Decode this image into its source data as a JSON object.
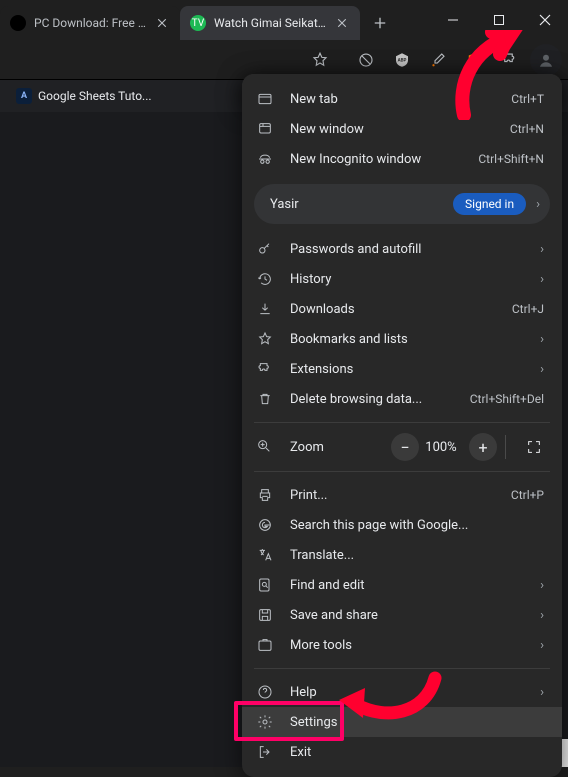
{
  "window": {
    "tabs": [
      {
        "title": "PC Download: Free do",
        "favicon_bg": "#000",
        "active": false
      },
      {
        "title": "Watch Gimai Seikatsu",
        "favicon_bg": "#1db954",
        "favicon_text": "TV",
        "active": true
      }
    ]
  },
  "bookmarks_bar": {
    "items": [
      {
        "label": "Google Sheets Tuto..."
      }
    ]
  },
  "menu": {
    "new_tab": {
      "label": "New tab",
      "shortcut": "Ctrl+T"
    },
    "new_window": {
      "label": "New window",
      "shortcut": "Ctrl+N"
    },
    "new_incognito": {
      "label": "New Incognito window",
      "shortcut": "Ctrl+Shift+N"
    },
    "profile": {
      "name": "Yasir",
      "badge": "Signed in"
    },
    "passwords": {
      "label": "Passwords and autofill"
    },
    "history": {
      "label": "History"
    },
    "downloads": {
      "label": "Downloads",
      "shortcut": "Ctrl+J"
    },
    "bookmarks": {
      "label": "Bookmarks and lists"
    },
    "extensions": {
      "label": "Extensions"
    },
    "clear_data": {
      "label": "Delete browsing data...",
      "shortcut": "Ctrl+Shift+Del"
    },
    "zoom": {
      "label": "Zoom",
      "value": "100%"
    },
    "print": {
      "label": "Print...",
      "shortcut": "Ctrl+P"
    },
    "search_page": {
      "label": "Search this page with Google..."
    },
    "translate": {
      "label": "Translate..."
    },
    "find": {
      "label": "Find and edit"
    },
    "save_share": {
      "label": "Save and share"
    },
    "more_tools": {
      "label": "More tools"
    },
    "help": {
      "label": "Help"
    },
    "settings": {
      "label": "Settings"
    },
    "exit": {
      "label": "Exit"
    }
  },
  "annotation": {
    "color": "#ff002f",
    "highlight_target": "settings"
  }
}
